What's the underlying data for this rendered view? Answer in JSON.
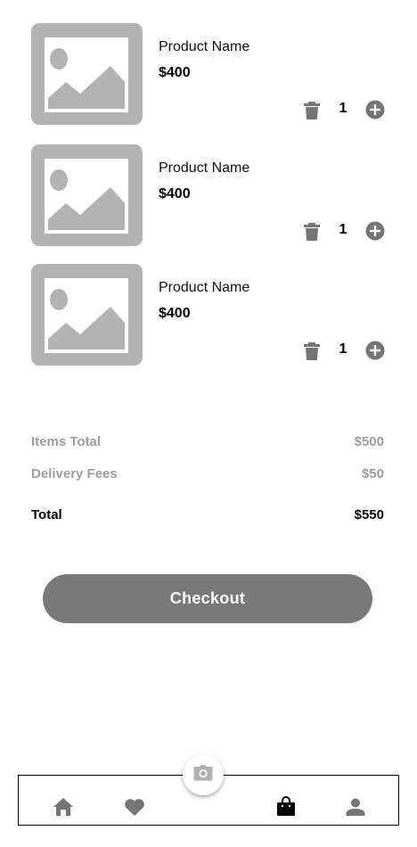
{
  "cart": {
    "items": [
      {
        "name": "Product Name",
        "price": "$400",
        "quantity": "1",
        "image_icon": "image-placeholder-icon",
        "remove_icon": "trash-icon",
        "increment_icon": "plus-circle-icon"
      },
      {
        "name": "Product Name",
        "price": "$400",
        "quantity": "1",
        "image_icon": "image-placeholder-icon",
        "remove_icon": "trash-icon",
        "increment_icon": "plus-circle-icon"
      },
      {
        "name": "Product Name",
        "price": "$400",
        "quantity": "1",
        "image_icon": "image-placeholder-icon",
        "remove_icon": "trash-icon",
        "increment_icon": "plus-circle-icon"
      }
    ]
  },
  "summary": {
    "items_total": {
      "label": "Items Total",
      "value": "$500"
    },
    "delivery_fees": {
      "label": "Delivery Fees",
      "value": "$50"
    },
    "total": {
      "label": "Total",
      "value": "$550"
    }
  },
  "checkout": {
    "label": "Checkout"
  },
  "bottom_nav": {
    "items": [
      {
        "icon": "home-icon",
        "active": false
      },
      {
        "icon": "heart-icon",
        "active": false
      },
      {
        "icon": "camera-icon",
        "active": false
      },
      {
        "icon": "shopping-bag-icon",
        "active": true
      },
      {
        "icon": "user-icon",
        "active": false
      }
    ]
  },
  "colors": {
    "placeholder_bg": "#b3b3b3",
    "icon_gray": "#757575",
    "muted_text": "#9e9e9e",
    "button_bg": "#797979",
    "active_icon": "#000000"
  }
}
